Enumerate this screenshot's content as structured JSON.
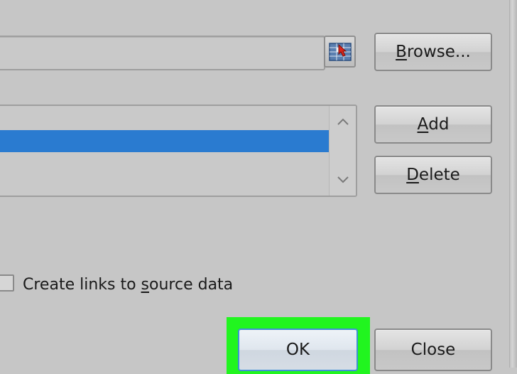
{
  "dialog": {
    "reference": {
      "value": "",
      "collapse_icon": "range-select-icon"
    },
    "buttons": {
      "browse": {
        "pre": "",
        "mnemonic": "B",
        "post": "rowse..."
      },
      "add": {
        "pre": "",
        "mnemonic": "A",
        "post": "dd"
      },
      "delete": {
        "pre": "",
        "mnemonic": "D",
        "post": "elete"
      },
      "ok": "OK",
      "close": "Close"
    },
    "references_list": {
      "selected_index": 0,
      "scroll_up_icon": "chevron-up-icon",
      "scroll_down_icon": "chevron-down-icon"
    },
    "create_links": {
      "checked": false,
      "label_pre": "Create links to ",
      "label_mnemonic": "s",
      "label_post": "ource data"
    }
  },
  "colors": {
    "selection": "#2a7bd0",
    "ok_highlight": "#21f51f",
    "background": "#c6c6c6"
  }
}
